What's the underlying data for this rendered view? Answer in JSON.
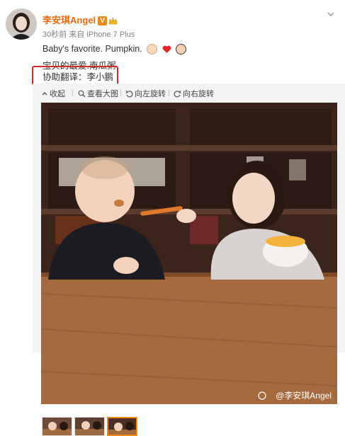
{
  "post": {
    "username": "李安琪Angel",
    "meta": "30秒前 来自 iPhone 7 Plus",
    "text_line1": "Baby's favorite. Pumpkin.",
    "text_line2": "宝贝的最爱.南瓜粥",
    "text_line3": "协助翻译：李小鹏"
  },
  "toolbar": {
    "collapse": "收起",
    "view_large": "查看大图",
    "rotate_left": "向左旋转",
    "rotate_right": "向右旋转"
  },
  "photo": {
    "watermark": "@李安琪Angel"
  },
  "colors": {
    "username": "#e86b0a",
    "highlight_border": "#d42a2a",
    "selected_thumb": "#f08a1a"
  },
  "icons": [
    "v-verified-icon",
    "crown-icon",
    "chevron-down-icon",
    "emoji-baby-icon",
    "heart-icon",
    "emoji-girl-icon",
    "collapse-icon",
    "magnify-icon",
    "rotate-left-icon",
    "rotate-right-icon",
    "weibo-icon"
  ]
}
